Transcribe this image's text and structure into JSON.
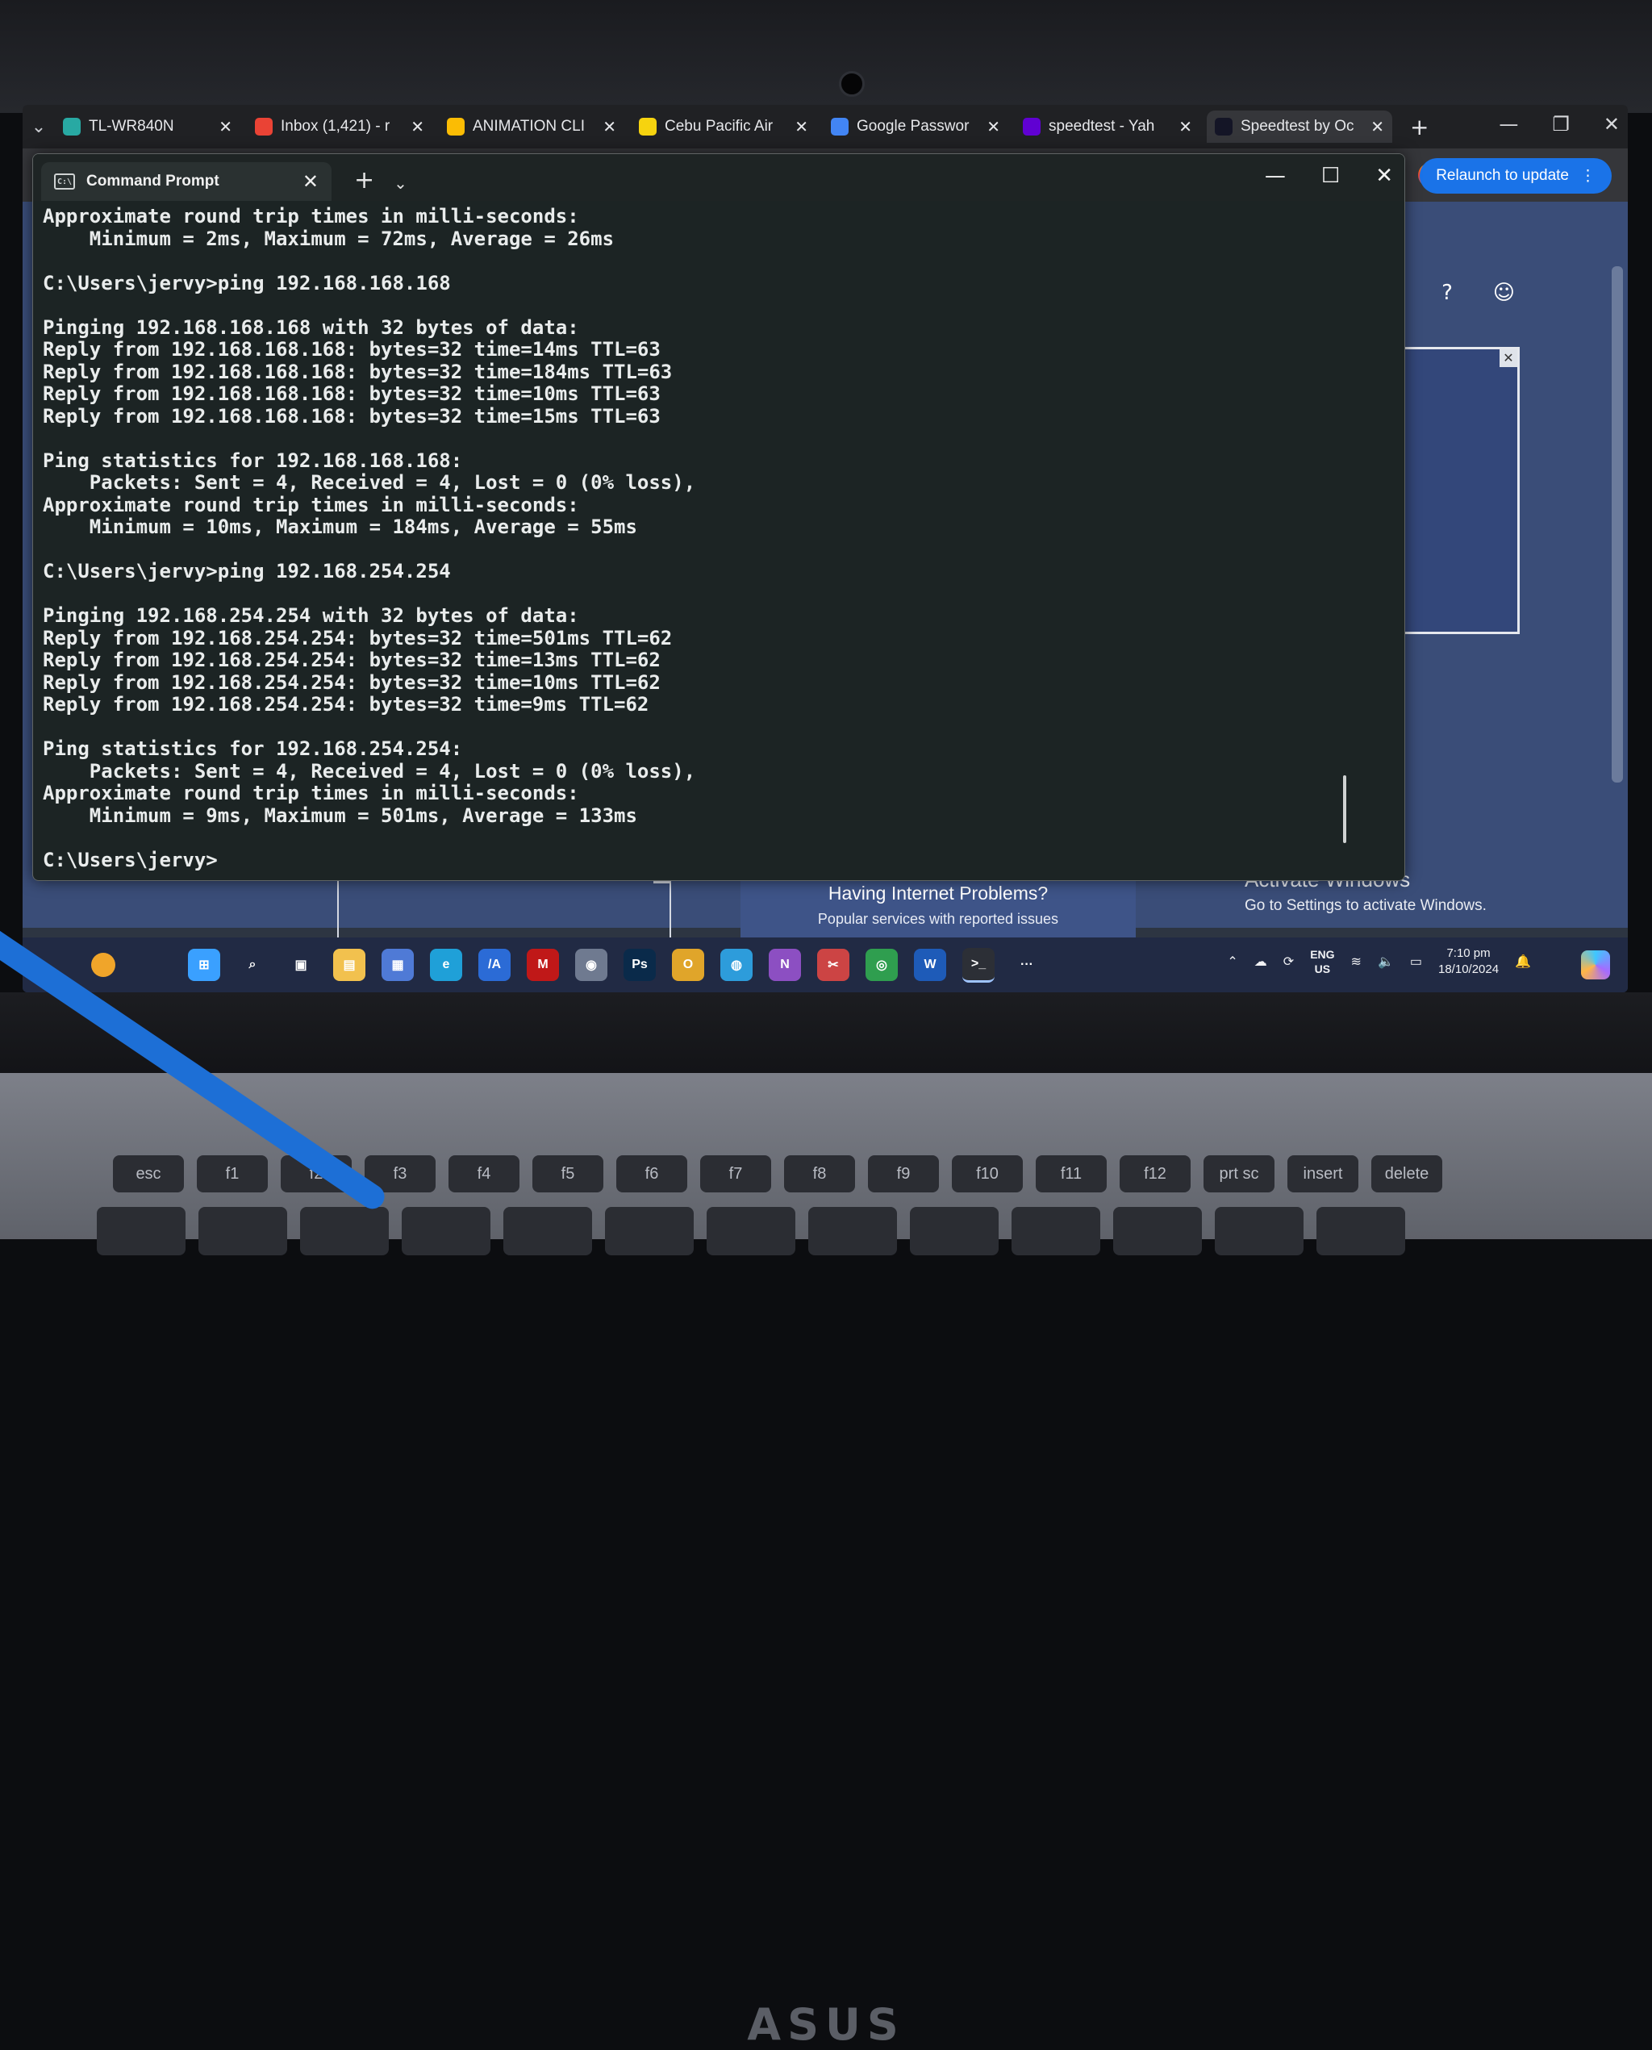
{
  "browser": {
    "tabs": [
      {
        "label": "TL-WR840N",
        "icon": "tplink-icon",
        "color": "#28a9a3"
      },
      {
        "label": "Inbox (1,421) - r",
        "icon": "gmail-icon",
        "color": "#ea4335"
      },
      {
        "label": "ANIMATION CLI",
        "icon": "google-drive-icon",
        "color": "#fbbc04"
      },
      {
        "label": "Cebu Pacific Air",
        "icon": "cebu-pacific-icon",
        "color": "#f6d30f"
      },
      {
        "label": "Google Passwor",
        "icon": "google-password-icon",
        "color": "#4285f4"
      },
      {
        "label": "speedtest - Yah",
        "icon": "yahoo-icon",
        "color": "#6001d2"
      },
      {
        "label": "Speedtest by Oc",
        "icon": "speedtest-icon",
        "color": "#141526"
      }
    ],
    "relaunch_label": "Relaunch to update"
  },
  "page": {
    "banner_title": "Having Internet Problems?",
    "banner_subtitle": "Popular services with reported issues"
  },
  "watermark": {
    "title": "Activate Windows",
    "subtitle": "Go to Settings to activate Windows."
  },
  "cmd": {
    "tab_title": "Command Prompt",
    "lines": [
      "Approximate round trip times in milli-seconds:",
      "    Minimum = 2ms, Maximum = 72ms, Average = 26ms",
      "",
      "C:\\Users\\jervy>ping 192.168.168.168",
      "",
      "Pinging 192.168.168.168 with 32 bytes of data:",
      "Reply from 192.168.168.168: bytes=32 time=14ms TTL=63",
      "Reply from 192.168.168.168: bytes=32 time=184ms TTL=63",
      "Reply from 192.168.168.168: bytes=32 time=10ms TTL=63",
      "Reply from 192.168.168.168: bytes=32 time=15ms TTL=63",
      "",
      "Ping statistics for 192.168.168.168:",
      "    Packets: Sent = 4, Received = 4, Lost = 0 (0% loss),",
      "Approximate round trip times in milli-seconds:",
      "    Minimum = 10ms, Maximum = 184ms, Average = 55ms",
      "",
      "C:\\Users\\jervy>ping 192.168.254.254",
      "",
      "Pinging 192.168.254.254 with 32 bytes of data:",
      "Reply from 192.168.254.254: bytes=32 time=501ms TTL=62",
      "Reply from 192.168.254.254: bytes=32 time=13ms TTL=62",
      "Reply from 192.168.254.254: bytes=32 time=10ms TTL=62",
      "Reply from 192.168.254.254: bytes=32 time=9ms TTL=62",
      "",
      "Ping statistics for 192.168.254.254:",
      "    Packets: Sent = 4, Received = 4, Lost = 0 (0% loss),",
      "Approximate round trip times in milli-seconds:",
      "    Minimum = 9ms, Maximum = 501ms, Average = 133ms",
      "",
      "C:\\Users\\jervy>"
    ]
  },
  "taskbar": {
    "apps": [
      {
        "name": "start-icon",
        "glyph": "⊞",
        "color": "#3aa0ff"
      },
      {
        "name": "search-icon",
        "glyph": "⌕",
        "color": "transparent"
      },
      {
        "name": "task-view-icon",
        "glyph": "▣",
        "color": "transparent"
      },
      {
        "name": "file-explorer-icon",
        "glyph": "▤",
        "color": "#f2c14e"
      },
      {
        "name": "microsoft-store-icon",
        "glyph": "▦",
        "color": "#4f7ad6"
      },
      {
        "name": "edge-icon",
        "glyph": "e",
        "color": "#1fa0d8"
      },
      {
        "name": "myasus-icon",
        "glyph": "/A",
        "color": "#2b6bd6"
      },
      {
        "name": "mcafee-icon",
        "glyph": "M",
        "color": "#c01818"
      },
      {
        "name": "camera-icon",
        "glyph": "◉",
        "color": "#6f7a90"
      },
      {
        "name": "photoshop-icon",
        "glyph": "Ps",
        "color": "#0a2a4a"
      },
      {
        "name": "outlook-icon",
        "glyph": "O",
        "color": "#e0a52a"
      },
      {
        "name": "copilot-app-icon",
        "glyph": "◍",
        "color": "#2d9cdb"
      },
      {
        "name": "onenote-icon",
        "glyph": "N",
        "color": "#8c4fc2"
      },
      {
        "name": "snipping-tool-icon",
        "glyph": "✂",
        "color": "#c44"
      },
      {
        "name": "chrome-icon",
        "glyph": "◎",
        "color": "#2f9e4f"
      },
      {
        "name": "word-icon",
        "glyph": "W",
        "color": "#1e5bb8"
      },
      {
        "name": "terminal-icon",
        "glyph": ">_",
        "color": "#2c2f36"
      },
      {
        "name": "more-apps-icon",
        "glyph": "···",
        "color": "transparent"
      }
    ],
    "lang": "ENG",
    "region": "US",
    "time": "7:10 pm",
    "date": "18/10/2024"
  },
  "laptop": {
    "brand": "ASUS",
    "fkeys": [
      "esc",
      "f1",
      "f2",
      "f3",
      "f4",
      "f5",
      "f6",
      "f7",
      "f8",
      "f9",
      "f10",
      "f11",
      "f12",
      "prt sc",
      "insert",
      "delete"
    ]
  }
}
